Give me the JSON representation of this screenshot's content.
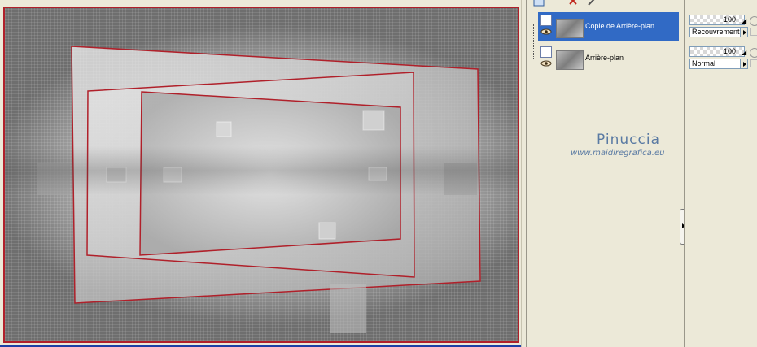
{
  "layers": [
    {
      "name": "Copie de Arrière-plan",
      "selected": true
    },
    {
      "name": "Arrière-plan",
      "selected": false
    }
  ],
  "properties": [
    {
      "opacity": "100",
      "blend_mode": "Recouvrement"
    },
    {
      "opacity": "100",
      "blend_mode": "Normal"
    }
  ],
  "watermark": {
    "name": "Pinuccia",
    "url": "www.maidiregrafica.eu"
  },
  "colors": {
    "frame": "#b0202a",
    "selection": "#316ac5",
    "watermark": "#5a7aa3",
    "panel": "#ece9d8"
  },
  "icons": {
    "toolbar": [
      "new-layer-icon",
      "delete-layer-icon",
      "properties-icon"
    ],
    "layer_row": [
      "visibility-eye-icon",
      "layer-thumbnail"
    ],
    "props_row": [
      "link-icon",
      "lock-icon"
    ]
  }
}
